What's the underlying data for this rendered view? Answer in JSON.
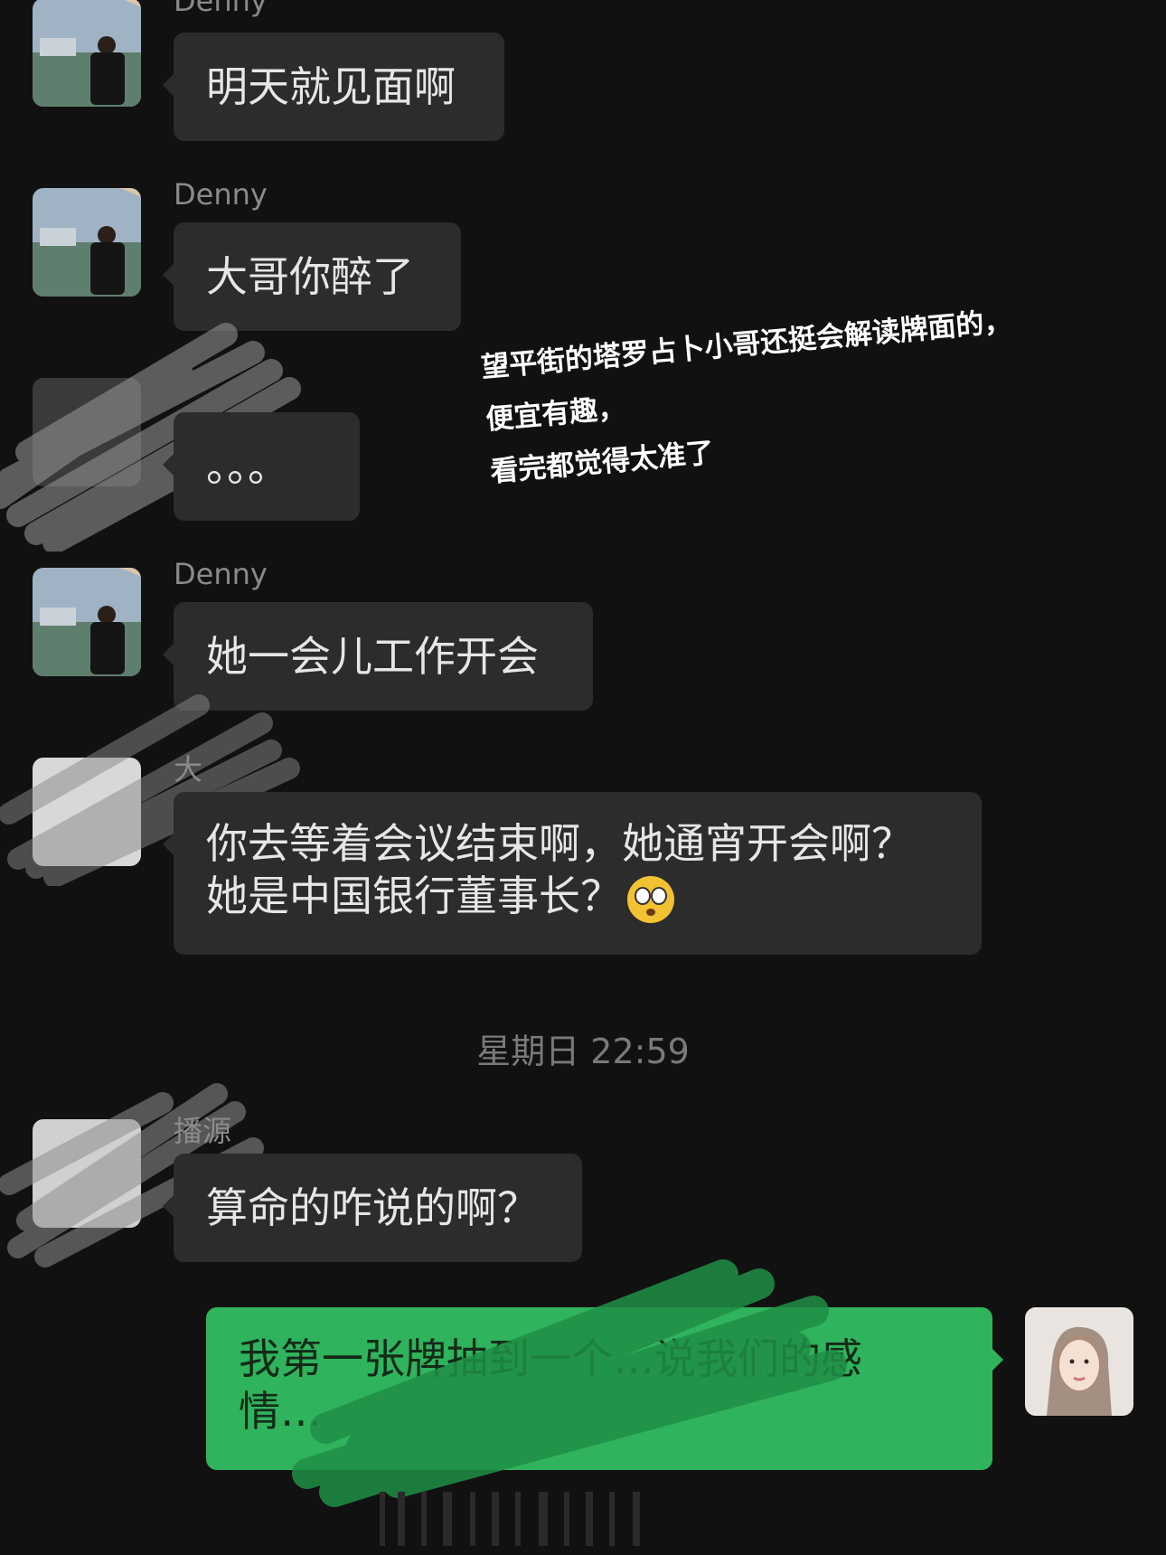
{
  "messages": [
    {
      "sender": "Denny",
      "text": "明天就见面啊"
    },
    {
      "sender": "Denny",
      "text": "大哥你醉了"
    },
    {
      "sender": "",
      "text": "。。。"
    },
    {
      "sender": "Denny",
      "text": "她一会儿工作开会"
    },
    {
      "sender": "大",
      "line1": "你去等着会议结束啊，她通宵开会啊？",
      "line2": "她是中国银行董事长？",
      "emoji": "flushed-face-emoji"
    },
    {
      "sender": "播源",
      "text": "算命的咋说的啊？"
    }
  ],
  "timestamp": "星期日 22:59",
  "my_message": {
    "line1": "我第一张牌抽到一个…说我们的感",
    "line2": "情…"
  },
  "overlay_note": [
    "望平街的塔罗占卜小哥还挺会解读牌面的，",
    "便宜有趣，",
    "看完都觉得太准了"
  ],
  "colors": {
    "background": "#111111",
    "bubble": "#2c2c2c",
    "my_bubble": "#2fb35c",
    "sender_name": "#8a8a8a"
  }
}
